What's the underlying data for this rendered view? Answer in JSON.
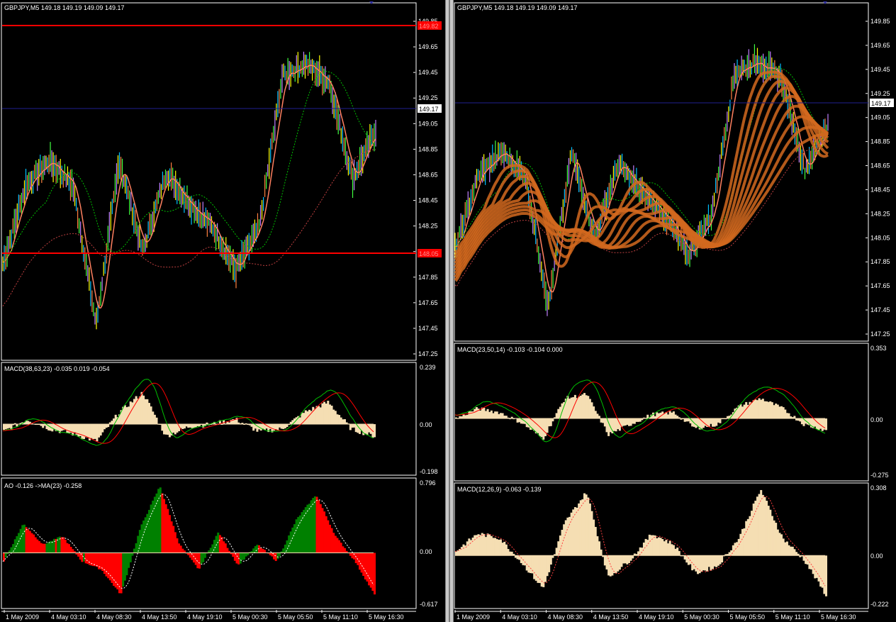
{
  "left": {
    "symbol_header": "GBPJPY,M5  149.18 149.19 149.09 149.17",
    "price_ticks": [
      "149.85",
      "149.65",
      "149.45",
      "149.25",
      "149.05",
      "148.85",
      "148.65",
      "148.45",
      "148.25",
      "148.05",
      "147.85",
      "147.65",
      "147.45",
      "147.25"
    ],
    "current_price_label": "149.17",
    "upper_line_label": "149.82",
    "lower_line_label": "148.05",
    "macd_header": "MACD(38,63,23) -0.035 0.019 -0.054",
    "macd_ticks": [
      "0.239",
      "0.00",
      "-0.198"
    ],
    "ao_header": "AO -0.126  ->MA(23) -0.258",
    "ao_ticks": [
      "0.796",
      "0.00",
      "-0.617"
    ],
    "time_ticks": [
      "1 May 2009",
      "4 May 03:10",
      "4 May 08:30",
      "4 May 13:50",
      "4 May 19:10",
      "5 May 00:30",
      "5 May 05:50",
      "5 May 11:10",
      "5 May 16:30"
    ]
  },
  "right": {
    "symbol_header": "GBPJPY,M5  149.18 149.19 149.09 149.17",
    "price_ticks": [
      "149.85",
      "149.65",
      "149.45",
      "149.25",
      "149.05",
      "148.85",
      "148.65",
      "148.45",
      "148.25",
      "148.05",
      "147.85",
      "147.65",
      "147.45",
      "147.25"
    ],
    "current_price_label": "149.17",
    "macd1_header": "MACD(23,50,14) -0.103 -0.104 0.000",
    "macd1_ticks": [
      "0.353",
      "0.00",
      "-0.275"
    ],
    "macd2_header": "MACD(12,26,9) -0.063 -0.139",
    "macd2_ticks": [
      "0.308",
      "0.00",
      "-0.222"
    ],
    "time_ticks": [
      "1 May 2009",
      "4 May 03:10",
      "4 May 08:30",
      "4 May 13:50",
      "4 May 19:10",
      "5 May 00:30",
      "5 May 05:50",
      "5 May 11:10",
      "5 May 16:30"
    ]
  },
  "colors": {
    "background": "#000000",
    "axis": "#ffffff",
    "level_line": "#ff0000",
    "current_price_line": "#1a1a8c",
    "macd_hist": "#f5deb3",
    "macd_main": "#00c000",
    "macd_signal": "#ff0000",
    "ao_up": "#008000",
    "ao_down": "#ff0000",
    "ribbon": "#d2691e"
  },
  "chart_data": [
    {
      "type": "line",
      "title": "GBPJPY,M5",
      "ylim": [
        147.2,
        149.95
      ],
      "x": [
        "1 May 2009",
        "4 May 03:10",
        "4 May 08:30",
        "4 May 13:50",
        "4 May 19:10",
        "5 May 00:30",
        "5 May 05:50",
        "5 May 11:10",
        "5 May 16:30"
      ],
      "series": [
        {
          "values": [
            147.95,
            148.6,
            148.8,
            148.6,
            147.45,
            148.8,
            148.05,
            148.7,
            148.45,
            148.25,
            147.9,
            148.25,
            149.5,
            149.6,
            149.45,
            148.65,
            149.05
          ]
        }
      ],
      "levels": [
        149.82,
        148.05
      ],
      "current": 149.17
    },
    {
      "type": "bar",
      "title": "MACD(38,63,23)",
      "ylim": [
        -0.198,
        0.239
      ],
      "values": [
        -0.03,
        0.02,
        -0.02,
        -0.04,
        -0.07,
        0.05,
        0.13,
        -0.05,
        -0.01,
        0.0,
        0.02,
        -0.03,
        -0.02,
        0.05,
        0.09,
        -0.02,
        -0.05
      ]
    },
    {
      "type": "bar",
      "title": "AO",
      "ylim": [
        -0.617,
        0.796
      ],
      "values": [
        -0.1,
        0.35,
        0.1,
        0.2,
        -0.1,
        -0.2,
        -0.5,
        0.3,
        0.8,
        0.1,
        -0.2,
        0.25,
        -0.15,
        0.1,
        -0.1,
        0.4,
        0.7,
        0.2,
        -0.1,
        -0.5
      ]
    },
    {
      "type": "line",
      "title": "GBPJPY,M5",
      "ylim": [
        147.2,
        149.95
      ],
      "x": [
        "1 May 2009",
        "4 May 03:10",
        "4 May 08:30",
        "4 May 13:50",
        "4 May 19:10",
        "5 May 00:30",
        "5 May 05:50",
        "5 May 11:10",
        "5 May 16:30"
      ],
      "series": [
        {
          "values": [
            147.95,
            148.6,
            148.8,
            148.6,
            147.45,
            148.8,
            148.05,
            148.7,
            148.45,
            148.25,
            147.9,
            148.25,
            149.5,
            149.6,
            149.45,
            148.65,
            149.05
          ]
        }
      ],
      "current": 149.17
    },
    {
      "type": "bar",
      "title": "MACD(23,50,14)",
      "ylim": [
        -0.275,
        0.353
      ],
      "values": [
        0.0,
        0.05,
        0.03,
        -0.02,
        -0.1,
        0.1,
        0.12,
        -0.08,
        -0.03,
        0.02,
        0.03,
        -0.05,
        -0.03,
        0.06,
        0.1,
        0.05,
        -0.03,
        -0.06
      ]
    },
    {
      "type": "bar",
      "title": "MACD(12,26,9)",
      "ylim": [
        -0.222,
        0.308
      ],
      "values": [
        0.02,
        0.1,
        0.08,
        -0.03,
        -0.15,
        0.15,
        0.29,
        -0.1,
        -0.02,
        0.1,
        0.05,
        -0.08,
        -0.05,
        0.08,
        0.3,
        0.08,
        -0.02,
        -0.18
      ]
    }
  ]
}
